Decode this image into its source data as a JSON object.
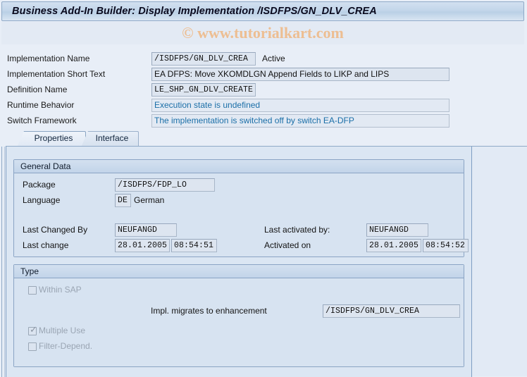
{
  "window": {
    "title": "Business Add-In Builder: Display Implementation /ISDFPS/GN_DLV_CREA"
  },
  "watermark": {
    "text": "© www.tutorialkart.com"
  },
  "header_fields": [
    {
      "label": "Implementation Name",
      "value": "/ISDFPS/GN_DLV_CREA",
      "status": "Active"
    },
    {
      "label": "Implementation Short Text",
      "value": "EA DFPS: Move XKOMDLGN Append Fields to LIKP and LIPS"
    },
    {
      "label": "Definition Name",
      "value": "LE_SHP_GN_DLV_CREATE"
    },
    {
      "label": "Runtime Behavior",
      "value": "Execution state is undefined"
    },
    {
      "label": "Switch Framework",
      "value": "The implementation is switched off by switch EA-DFP"
    }
  ],
  "tabs": [
    {
      "label": "Properties",
      "active": true
    },
    {
      "label": "Interface",
      "active": false
    }
  ],
  "general_data": {
    "title": "General Data",
    "package_label": "Package",
    "package_value": "/ISDFPS/FDP_LO",
    "language_label": "Language",
    "language_code": "DE",
    "language_text": "German",
    "last_changed_by_label": "Last Changed By",
    "last_changed_by_value": "NEUFANGD",
    "last_change_label": "Last change",
    "last_change_date": "28.01.2005",
    "last_change_time": "08:54:51",
    "last_activated_by_label": "Last activated by:",
    "last_activated_by_value": "NEUFANGD",
    "activated_on_label": "Activated on",
    "activated_on_date": "28.01.2005",
    "activated_on_time": "08:54:52"
  },
  "type_section": {
    "title": "Type",
    "within_sap_label": "Within SAP",
    "within_sap_checked": false,
    "multiple_use_label": "Multiple Use",
    "multiple_use_checked": true,
    "filter_depend_label": "Filter-Depend.",
    "filter_depend_checked": false,
    "migrates_label": "Impl. migrates to enhancement",
    "migrates_value": "/ISDFPS/GN_DLV_CREA",
    "checkmark_glyph": "✓"
  },
  "colors": {
    "accent": "#1b6fa8",
    "watermark": "#edbe92",
    "panel_bg": "#dbe6f3",
    "field_bg": "#dde5f0"
  }
}
